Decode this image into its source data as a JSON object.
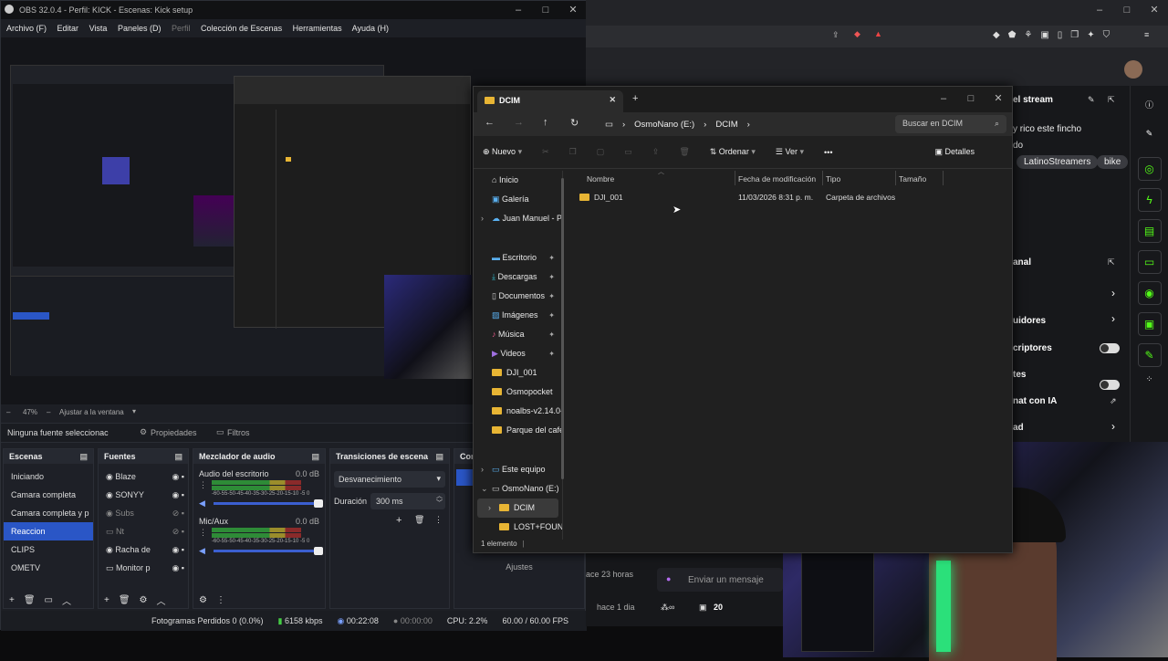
{
  "obs": {
    "title": "OBS 32.0.4 - Perfil: KICK - Escenas: Kick setup",
    "menu": [
      "Archivo (F)",
      "Editar",
      "Vista",
      "Paneles (D)",
      "Perfil",
      "Colección de Escenas",
      "Herramientas",
      "Ayuda (H)"
    ],
    "zoom": "47%",
    "fit": "Ajustar a la ventana",
    "no_source": "Ninguna fuente seleccionac",
    "properties": "Propiedades",
    "filters": "Filtros",
    "scenes_title": "Escenas",
    "scenes": [
      "Iniciando",
      "Camara completa",
      "Camara completa y p",
      "Reaccion",
      "CLIPS",
      "OMETV"
    ],
    "selected_scene": 3,
    "sources_title": "Fuentes",
    "sources": [
      "Blaze",
      "SONYY",
      "Subs",
      "Nt",
      "Racha de",
      "Monitor p"
    ],
    "mixer_title": "Mezclador de audio",
    "mixer": [
      {
        "name": "Audio del escritorio",
        "db": "0.0 dB",
        "fill": 0.82
      },
      {
        "name": "Mic/Aux",
        "db": "0.0 dB",
        "fill": 0.82
      }
    ],
    "meter_ticks": "-60-55-50-45-40-35-30-25-20-15-10 -5 0",
    "transitions_title": "Transiciones de escena",
    "transition": "Desvanecimiento",
    "duration_label": "Duración",
    "duration": "300 ms",
    "controls_title": "Con",
    "settings": "Ajustes",
    "status": {
      "dropped": "Fotogramas Perdidos 0 (0.0%)",
      "kbps": "6158 kbps",
      "live": "00:22:08",
      "rec": "00:00:00",
      "cpu": "CPU: 2.2%",
      "fps": "60.00 / 60.00 FPS"
    }
  },
  "explorer": {
    "tab": "DCIM",
    "path": [
      "OsmoNano (E:)",
      "DCIM"
    ],
    "search_placeholder": "Buscar en DCIM",
    "new": "Nuevo",
    "sort": "Ordenar",
    "view": "Ver",
    "details": "Detalles",
    "nav": [
      {
        "label": "Inicio",
        "pin": false
      },
      {
        "label": "Galería",
        "pin": false
      },
      {
        "label": "Juan Manuel - P",
        "pin": false
      },
      {
        "label": "Escritorio",
        "pin": true
      },
      {
        "label": "Descargas",
        "pin": true
      },
      {
        "label": "Documentos",
        "pin": true
      },
      {
        "label": "Imágenes",
        "pin": true
      },
      {
        "label": "Música",
        "pin": true
      },
      {
        "label": "Videos",
        "pin": true
      },
      {
        "label": "DJI_001",
        "pin": false
      },
      {
        "label": "Osmopocket",
        "pin": false
      },
      {
        "label": "noalbs-v2.14.0-",
        "pin": false
      },
      {
        "label": "Parque del cafe",
        "pin": false
      },
      {
        "label": "Este equipo",
        "pin": false
      },
      {
        "label": "OsmoNano (E:)",
        "pin": false
      },
      {
        "label": "DCIM",
        "pin": false
      },
      {
        "label": "LOST+FOUND",
        "pin": false
      }
    ],
    "columns": [
      "Nombre",
      "Fecha de modificación",
      "Tipo",
      "Tamaño"
    ],
    "file": {
      "name": "DJI_001",
      "date": "11/03/2026 8:31 p. m.",
      "type": "Carpeta de archivos"
    },
    "count": "1 elemento"
  },
  "kick": {
    "stream_title": "el stream",
    "msg": "y rico este fincho",
    "label": "do",
    "chips": [
      "LatinoStreamers",
      "bike"
    ],
    "canal": "anal",
    "seguidores": "uidores",
    "suscriptores": "criptores",
    "tes": "tes",
    "chat_ia": "nat con IA",
    "ad": "ad",
    "time1": "ace 23 horas",
    "time2": "hace 1 dia",
    "chat_placeholder": "Enviar un mensaje",
    "viewers": "20"
  },
  "colors": {
    "accent": "#2a56c6",
    "kick_green": "#53fc18",
    "folder": "#e8b534"
  }
}
